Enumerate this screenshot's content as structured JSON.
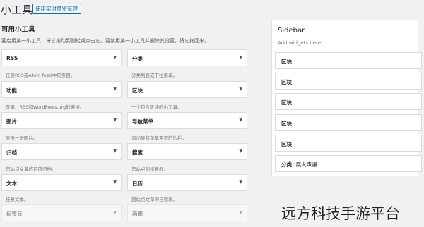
{
  "header": {
    "title": "小工具",
    "manage_button": "使用实时预览管理"
  },
  "available": {
    "title": "可用小工具",
    "description": "要启用某一小工具，将它拖动到侧栏或点击它。要禁用某一小工具并删除其设置，将它拖回来。",
    "widgets": [
      {
        "name": "RSS",
        "desc": "任意RSS或Atom feed中的条目。"
      },
      {
        "name": "分类",
        "desc": "分类列表或下拉菜单。"
      },
      {
        "name": "功能",
        "desc": "登录、RSS和WordPress.org的链接。"
      },
      {
        "name": "区块",
        "desc": "一个包含区块的小工具。"
      },
      {
        "name": "图片",
        "desc": "显示一张图片。"
      },
      {
        "name": "导航菜单",
        "desc": "添加导航菜单至您的边栏。"
      },
      {
        "name": "归档",
        "desc": "您站点文章的月度归档。"
      },
      {
        "name": "搜索",
        "desc": "您站点的搜索框。"
      },
      {
        "name": "文本",
        "desc": "任意文本。"
      },
      {
        "name": "日历",
        "desc": "您站点文章的日程表。"
      },
      {
        "name": "标签云",
        "desc": ""
      },
      {
        "name": "画廊",
        "desc": ""
      }
    ]
  },
  "sidebar": {
    "title": "Sidebar",
    "hint": "Add widgets here.",
    "widgets": [
      {
        "name": "区块",
        "sub": ""
      },
      {
        "name": "区块",
        "sub": ""
      },
      {
        "name": "区块",
        "sub": ""
      },
      {
        "name": "区块",
        "sub": ""
      },
      {
        "name": "区块",
        "sub": ""
      },
      {
        "name": "分类:",
        "sub": "展大声遇"
      }
    ]
  },
  "watermark": "远方科技手游平台"
}
